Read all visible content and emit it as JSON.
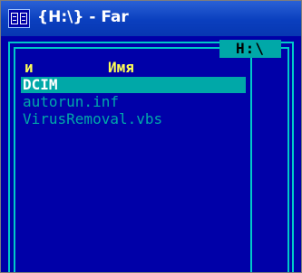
{
  "window": {
    "title": "{H:\\} - Far",
    "icon": "far-manager-icon"
  },
  "panel": {
    "path": "H:\\",
    "columns": {
      "marker": "и",
      "name": "Имя"
    },
    "files": [
      {
        "name": "DCIM",
        "selected": true
      },
      {
        "name": "autorun.inf",
        "selected": false
      },
      {
        "name": "VirusRemoval.vbs",
        "selected": false
      }
    ]
  },
  "colors": {
    "panel_background": "#0000a8",
    "frame": "#00c8c8",
    "cursor": "#00a8a8",
    "header_text": "#ffff55",
    "file_text": "#00a8a8"
  }
}
